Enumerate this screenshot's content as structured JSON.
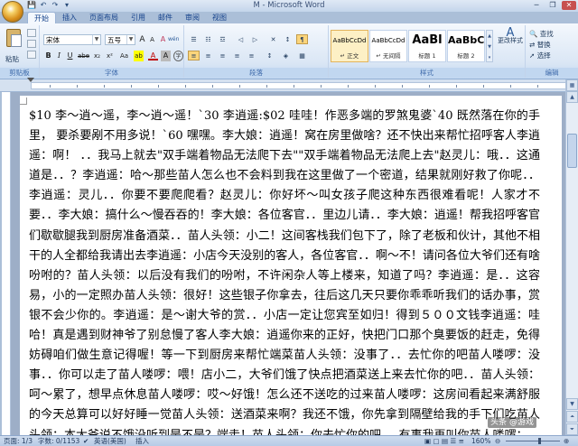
{
  "window": {
    "title": "M - Microsoft Word"
  },
  "qat": {
    "save": "💾",
    "undo": "↶",
    "redo": "↷",
    "more": "▾"
  },
  "winbtns": {
    "minimize": "─",
    "maximize": "❐",
    "close": "✕"
  },
  "tabs": [
    {
      "label": "开始",
      "active": true
    },
    {
      "label": "插入"
    },
    {
      "label": "页面布局"
    },
    {
      "label": "引用"
    },
    {
      "label": "邮件"
    },
    {
      "label": "审阅"
    },
    {
      "label": "视图"
    }
  ],
  "clipboard": {
    "paste_label": "粘贴",
    "group_label": "剪贴板"
  },
  "font": {
    "name": "宋体",
    "size": "五号",
    "grow": "A",
    "shrink": "A",
    "clear": "A",
    "wen": "wén",
    "frame": "A",
    "bold": "B",
    "italic": "I",
    "underline": "U",
    "strike": "abe",
    "subscript": "x₂",
    "superscript": "x²",
    "case": "Aa",
    "highlight": "ab",
    "fontcolor": "A",
    "charshade": "A",
    "enclosed": "字",
    "group_label": "字体"
  },
  "paragraph": {
    "group_label": "段落",
    "bullets": "☰",
    "numbering": "☷",
    "multilevel": "☲",
    "decrease": "◁",
    "increase": "▷",
    "chinese": "✕",
    "sort": "↕",
    "marks": "¶",
    "left": "≡",
    "center": "≡",
    "right": "≡",
    "justify": "≡",
    "distributed": "≡",
    "spacing": "↕",
    "shading": "◈",
    "border": "▦"
  },
  "styles": {
    "group_label": "样式",
    "items": [
      {
        "sample": "AaBbCcDd",
        "name": "↵ 正文"
      },
      {
        "sample": "AaBbCcDd",
        "name": "↵ 无间隔"
      },
      {
        "sample": "AaBl",
        "name": "标题 1"
      },
      {
        "sample": "AaBbC",
        "name": "标题 2"
      }
    ],
    "change_label": "更改样式"
  },
  "editing": {
    "group_label": "编辑",
    "find": "查找",
    "replace": "替换",
    "select": "选择"
  },
  "document": {
    "text": "$10 李～逍～遥，李～逍～遥！`30 李逍遥:$02 哇哇！作恶多端的罗煞鬼婆`40 既然落在你的手里，   要杀要剐不用多说！`60 嘿嘿。李大娘：逍遥！窝在房里做啥？还不快出来帮忙招呼客人李逍遥：啊！   ．．我马上就去\"双手端着物品无法爬下去\"\"双手端着物品无法爬上去\"赵灵儿：哦．．这通道是．．？李逍遥：哈～那些苗人怎么也不会料到我在这里做了一个密道，结果就刚好救了你呢．．李逍遥：灵儿．．你要不要爬爬看？赵灵儿：你好坏～叫女孩子爬这种东西很难看呢！人家才不要．．李大娘：搞什么～慢吞吞的！李大娘：各位客官．．里边儿请．．李大娘：逍遥！帮我招呼客官们歇歇腿我到厨房准备酒菜．．苗人头领：小二！这间客栈我们包下了，除了老板和伙计，其他不相干的人全都给我请出去李逍遥：小店今天没别的客人，各位客官．．啊～不！请问各位大爷们还有啥吩咐的？苗人头领：以后没有我们的吩咐，不许闲杂人等上楼来，知道了吗？李逍遥：是．．这容易，小的一定照办苗人头领：很好！这些银子你拿去，往后这几天只要你乖乖听我们的话办事，赏银不会少你的。李逍遥：是～谢大爷的赏．．小店一定让您宾至如归！得到５００文钱李逍遥：哇哈！真是遇到财神爷了别怠慢了客人李大娘：逍遥你来的正好，快把门口那个臭要饭的赶走，免得妨碍咱们做生意记得喔！等一下到厨房来帮忙端菜苗人头领：没事了．．去忙你的吧苗人喽啰：没事．．你可以走了苗人喽啰：喂！店小二，大爷们饿了快点把酒菜送上来去忙你的吧．．苗人头领：呵～累了，想早点休息苗人喽啰：哎～好饿！怎么还不送吃的过来苗人喽啰：这房间看起来满舒服的今天总算可以好好睡一觉苗人头领：送酒菜来啊？我还不饿，你先拿到隔壁给我的手下们吃苗人头领：本大爷说不饿没听到是不是？端走！苗人头领：你去忙你的吧．．有事我再叫你苗人喽啰："
  },
  "status": {
    "page": "页面: 1/3",
    "words": "字数: 0/1153",
    "lang": "英语(美国)",
    "mode": "插入",
    "zoom": "160%"
  },
  "watermark": "头条 @游戏"
}
